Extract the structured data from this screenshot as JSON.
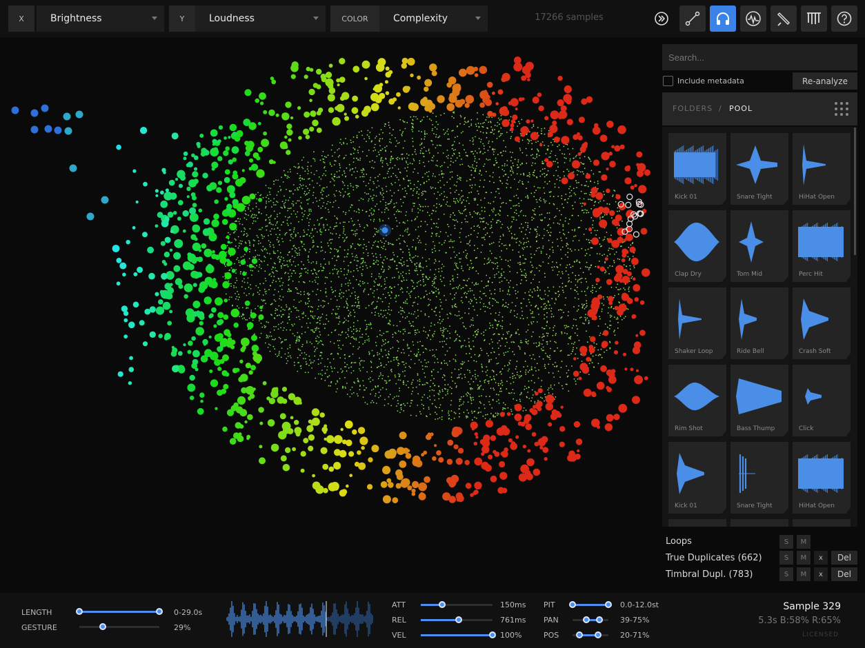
{
  "topbar": {
    "x_tag": "X",
    "x_value": "Brightness",
    "y_tag": "Y",
    "y_value": "Loudness",
    "color_tag": "COLOR",
    "color_value": "Complexity",
    "samples_count": "17266 samples",
    "tools": [
      "skip-forward-icon",
      "line-connect-icon",
      "headphones-icon",
      "waveform-circle-icon",
      "pencil-icon",
      "pipes-icon",
      "help-icon"
    ]
  },
  "sidebar": {
    "search_placeholder": "Search...",
    "include_metadata": "Include metadata",
    "reanalyze": "Re-analyze",
    "breadcrumb_folders": "FOLDERS",
    "breadcrumb_sep": "/",
    "breadcrumb_pool": "POOL",
    "tiles": [
      {
        "label": "Kick 01",
        "shape": "block"
      },
      {
        "label": "Snare Tight",
        "shape": "burst"
      },
      {
        "label": "HiHat Open",
        "shape": "spike"
      },
      {
        "label": "Clap Dry",
        "shape": "blob"
      },
      {
        "label": "Tom Mid",
        "shape": "diamond"
      },
      {
        "label": "Perc Hit",
        "shape": "dense"
      },
      {
        "label": "Shaker Loop",
        "shape": "spike"
      },
      {
        "label": "Ride Bell",
        "shape": "spike-mid"
      },
      {
        "label": "Crash Soft",
        "shape": "decay"
      },
      {
        "label": "Rim Shot",
        "shape": "blob-small"
      },
      {
        "label": "Bass Thump",
        "shape": "wedge"
      },
      {
        "label": "Click",
        "shape": "tiny"
      },
      {
        "label": "Kick 01",
        "shape": "decay"
      },
      {
        "label": "Snare Tight",
        "shape": "lines"
      },
      {
        "label": "HiHat Open",
        "shape": "dense"
      }
    ],
    "groups": [
      {
        "label": "Loops",
        "buttons": [
          "S",
          "M"
        ]
      },
      {
        "label": "True Duplicates (662)",
        "buttons": [
          "S",
          "M",
          "x"
        ],
        "del": "Del"
      },
      {
        "label": "Timbral Dupl. (783)",
        "buttons": [
          "S",
          "M",
          "x"
        ],
        "del": "Del"
      }
    ]
  },
  "params_left": [
    {
      "label": "LENGTH",
      "value": "0-29.0s",
      "range": [
        0,
        1
      ]
    },
    {
      "label": "GESTURE",
      "value": "29%",
      "range": [
        0.29,
        0.29
      ]
    }
  ],
  "params_mid": [
    {
      "label": "ATT",
      "value": "150ms",
      "level": 0.3
    },
    {
      "label": "REL",
      "value": "761ms",
      "level": 0.53
    },
    {
      "label": "VEL",
      "value": "100%",
      "level": 1.0
    }
  ],
  "params_right": [
    {
      "label": "PIT",
      "value": "0.0-12.0st",
      "range": [
        0,
        1
      ]
    },
    {
      "label": "PAN",
      "value": "39-75%",
      "range": [
        0.39,
        0.75
      ]
    },
    {
      "label": "POS",
      "value": "20-71%",
      "range": [
        0.2,
        0.71
      ]
    }
  ],
  "sample": {
    "title": "Sample 329",
    "info": "5.3s  B:58%  R:65%",
    "licensed": "LICENSED"
  }
}
